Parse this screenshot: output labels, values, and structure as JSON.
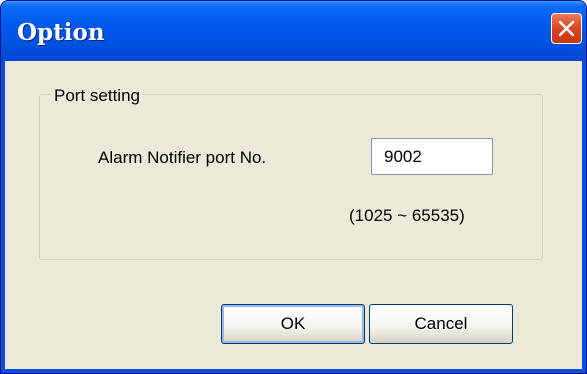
{
  "window": {
    "title": "Option",
    "close_icon": "close-icon"
  },
  "group": {
    "legend": "Port setting",
    "port_label": "Alarm Notifier port No.",
    "port_value": "9002",
    "range_hint": "(1025 ~ 65535)"
  },
  "buttons": {
    "ok_label": "OK",
    "cancel_label": "Cancel"
  },
  "colors": {
    "titlebar": "#0058ee",
    "dialog_background": "#ece9d8",
    "close_button": "#d8461f"
  }
}
